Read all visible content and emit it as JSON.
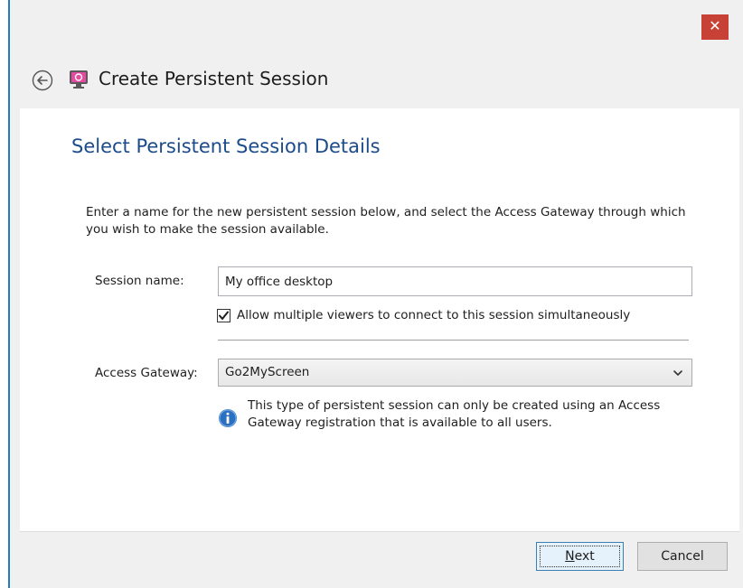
{
  "window": {
    "close_glyph": "✕"
  },
  "header": {
    "title": "Create Persistent Session",
    "back_icon": "back-arrow-icon",
    "app_icon": "app-icon"
  },
  "page": {
    "heading": "Select Persistent Session Details",
    "intro": "Enter a name for the new persistent session below, and select the Access Gateway through which you wish to make the session available."
  },
  "form": {
    "session_name_label": "Session name:",
    "session_name_value": "My office desktop",
    "allow_multiple_checked": true,
    "allow_multiple_label": "Allow multiple viewers to connect to this session simultaneously",
    "gateway_label": "Access Gateway:",
    "gateway_value": "Go2MyScreen",
    "info_text": "This type of persistent session can only be created using an Access Gateway registration that is available to all users."
  },
  "footer": {
    "next_label": "Next",
    "next_mnemonic": "N",
    "next_rest": "ext",
    "cancel_label": "Cancel"
  },
  "colors": {
    "accent_border": "#1f7fb8",
    "close_button": "#c84136",
    "heading": "#1c4b8c",
    "info_icon": "#2a6fc0"
  }
}
